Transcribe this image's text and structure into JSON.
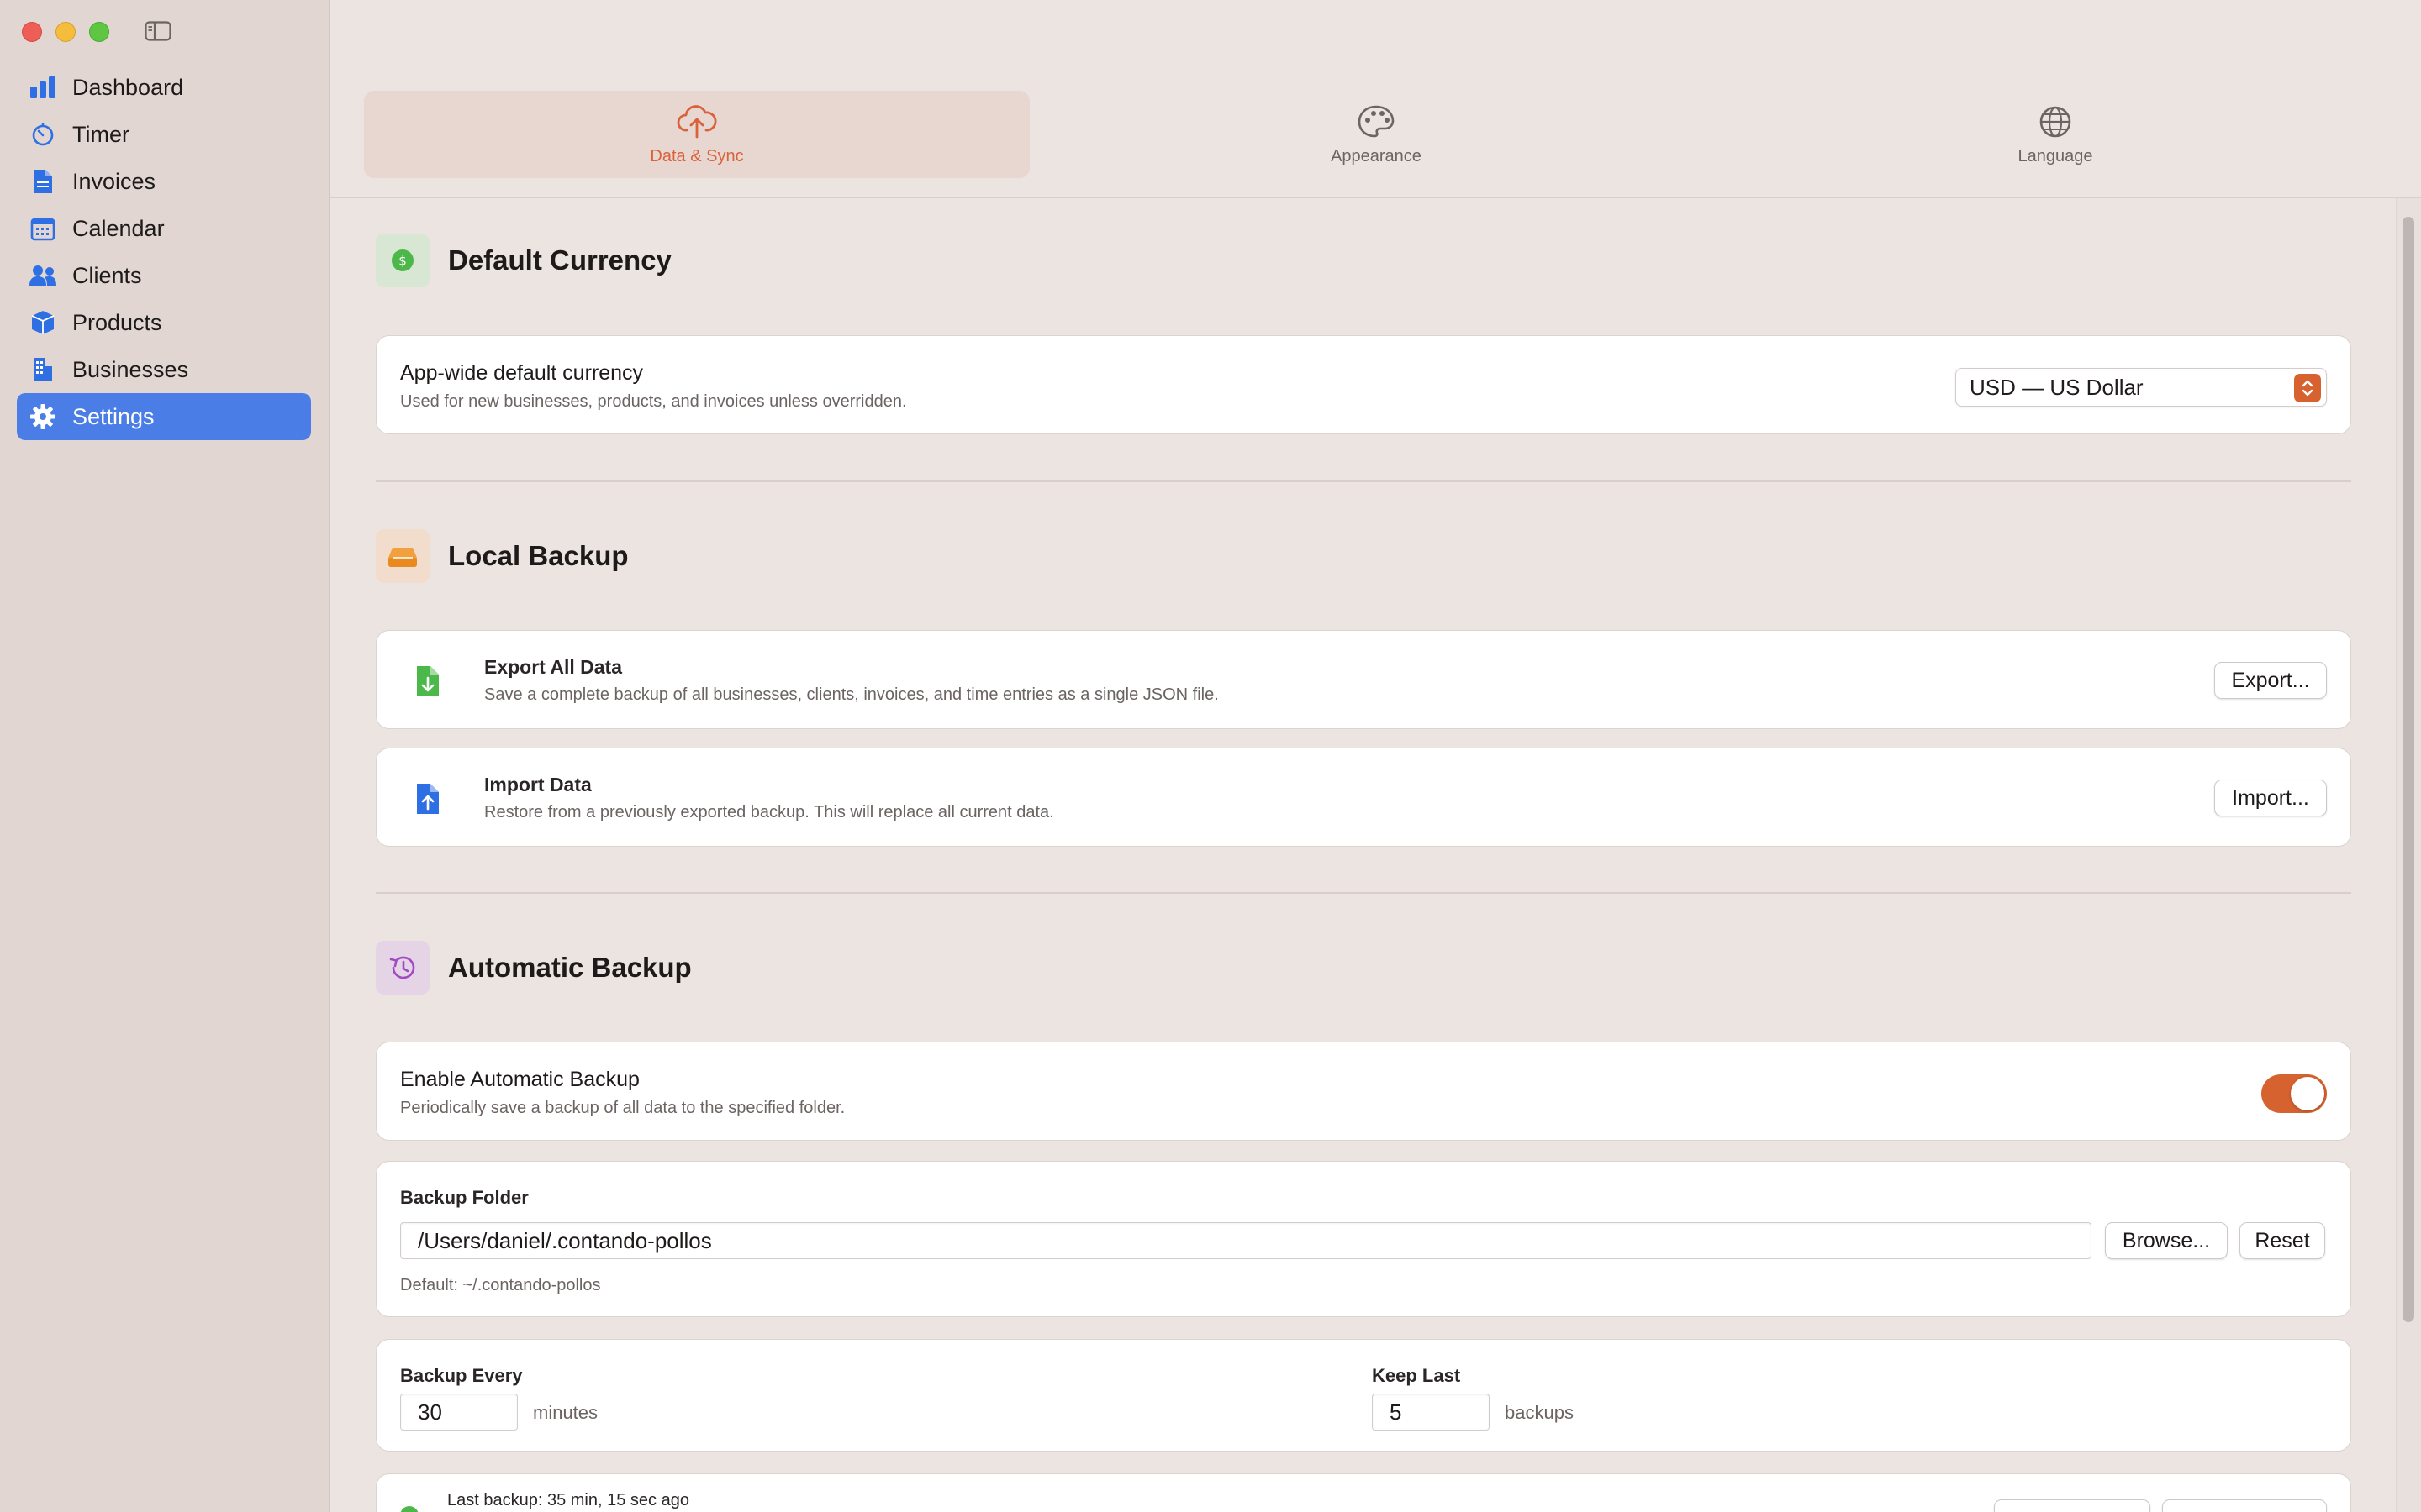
{
  "sidebar": {
    "items": [
      {
        "label": "Dashboard",
        "icon": "chart-bar-icon",
        "active": false
      },
      {
        "label": "Timer",
        "icon": "timer-icon",
        "active": false
      },
      {
        "label": "Invoices",
        "icon": "document-icon",
        "active": false
      },
      {
        "label": "Calendar",
        "icon": "calendar-icon",
        "active": false
      },
      {
        "label": "Clients",
        "icon": "people-icon",
        "active": false
      },
      {
        "label": "Products",
        "icon": "cube-icon",
        "active": false
      },
      {
        "label": "Businesses",
        "icon": "building-icon",
        "active": false
      },
      {
        "label": "Settings",
        "icon": "gear-icon",
        "active": true
      }
    ]
  },
  "tabs": [
    {
      "label": "Data & Sync",
      "icon": "cloud-upload-icon",
      "active": true
    },
    {
      "label": "Appearance",
      "icon": "palette-icon",
      "active": false
    },
    {
      "label": "Language",
      "icon": "globe-icon",
      "active": false
    }
  ],
  "currency": {
    "title": "Default Currency",
    "row_title": "App-wide default currency",
    "row_sub": "Used for new businesses, products, and invoices unless overridden.",
    "selected": "USD — US Dollar"
  },
  "local_backup": {
    "title": "Local Backup",
    "export": {
      "title": "Export All Data",
      "sub": "Save a complete backup of all businesses, clients, invoices, and time entries as a single JSON file.",
      "button": "Export..."
    },
    "import": {
      "title": "Import Data",
      "sub": "Restore from a previously exported backup. This will replace all current data.",
      "button": "Import..."
    }
  },
  "auto_backup": {
    "title": "Automatic Backup",
    "enable_title": "Enable Automatic Backup",
    "enable_sub": "Periodically save a backup of all data to the specified folder.",
    "enabled": true,
    "folder_label": "Backup Folder",
    "folder_value": "/Users/daniel/.contando-pollos",
    "browse_button": "Browse...",
    "reset_button": "Reset",
    "folder_default": "Default: ~/.contando-pollos",
    "every_label": "Backup Every",
    "every_value": "30",
    "every_unit": "minutes",
    "keep_label": "Keep Last",
    "keep_value": "5",
    "keep_unit": "backups",
    "last_backup": "Last backup: 35 min, 15 sec ago"
  },
  "colors": {
    "accent": "#d9623a",
    "sidebar_active": "#4a7de6",
    "toggle_on": "#d5622f"
  }
}
